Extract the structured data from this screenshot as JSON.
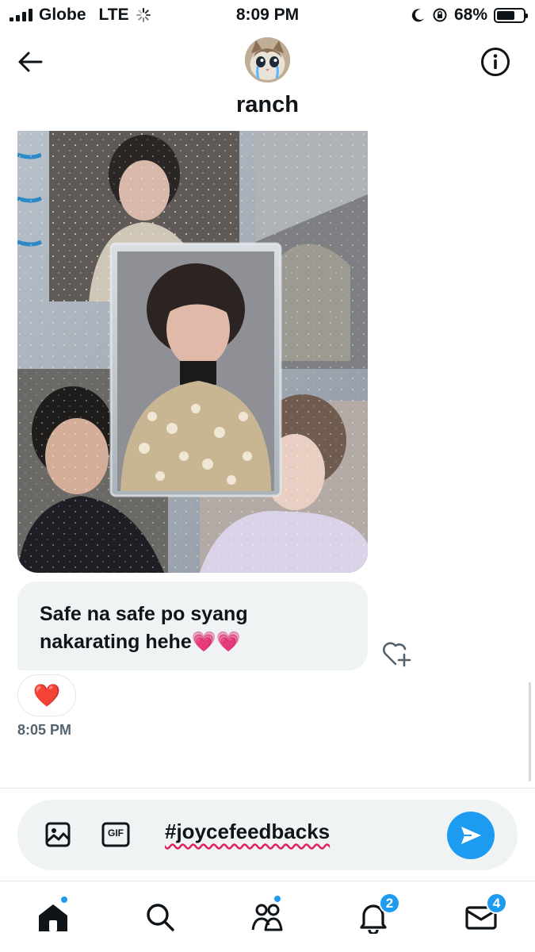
{
  "status_bar": {
    "carrier": "Globe",
    "network": "LTE",
    "time": "8:09 PM",
    "battery": "68%",
    "battery_level": 0.68
  },
  "header": {
    "contact_name": "ranch",
    "back_icon": "arrow-left-icon",
    "info_icon": "info-icon"
  },
  "conversation": {
    "media_message": {
      "type": "photo"
    },
    "text_message": "Safe na safe po syang nakarating hehe💗💗",
    "reaction": "❤️",
    "timestamp": "8:05 PM"
  },
  "composer": {
    "input_value": "#joycefeedbacks",
    "image_icon": "image-icon",
    "gif_label": "GIF",
    "send_icon": "send-icon"
  },
  "bottom_nav": {
    "items": [
      {
        "name": "home",
        "icon": "home-icon",
        "has_dot": true
      },
      {
        "name": "search",
        "icon": "search-icon",
        "has_dot": false
      },
      {
        "name": "communities",
        "icon": "people-icon",
        "has_dot": true
      },
      {
        "name": "notifications",
        "icon": "bell-icon",
        "badge": "2"
      },
      {
        "name": "messages",
        "icon": "envelope-icon",
        "badge": "4"
      }
    ]
  },
  "colors": {
    "accent": "#1d9bf0",
    "bubble": "#eff3f4",
    "text": "#0f1419",
    "muted": "#536471"
  }
}
